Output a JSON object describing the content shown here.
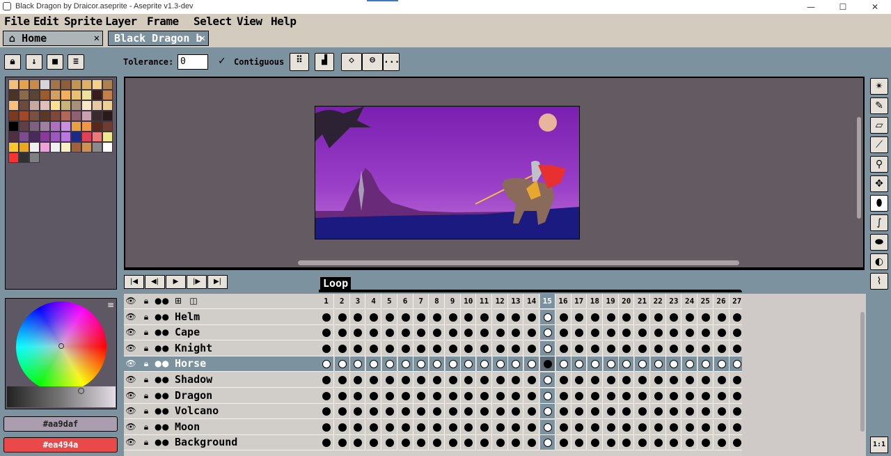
{
  "window": {
    "title": "Black Dragon by Draicor.aseprite - Aseprite v1.3-dev",
    "min": "—",
    "max": "☐",
    "close": "✕"
  },
  "menu": [
    "File",
    "Edit",
    "Sprite",
    "Layer",
    "Frame",
    "Select",
    "View",
    "Help"
  ],
  "tabs": [
    {
      "label": "Home",
      "icon": "home-icon",
      "close": "✕"
    },
    {
      "label": "Black Dragon b",
      "close": "✕"
    }
  ],
  "toolbar": {
    "tolerance_label": "Tolerance:",
    "tolerance_value": "0",
    "contiguous_label": "Contiguous",
    "contiguous_checked": "✓",
    "more": "..."
  },
  "layer_buttons": [
    "lock-icon",
    "arrow-down-icon",
    "square-icon",
    "menu-icon"
  ],
  "palette": [
    "#f3c07a",
    "#e4a14e",
    "#c98b45",
    "#d6d6d6",
    "#a57548",
    "#8d5e3a",
    "#c3964f",
    "#dfb06a",
    "#f5d08a",
    "#b07f4f",
    "#4a3424",
    "#8a6a4a",
    "#5a4434",
    "#9a5e2e",
    "#d4a060",
    "#f0b060",
    "#e8c070",
    "#f0e0a0",
    "#3a1a1a",
    "#c4804a",
    "#f8c078",
    "#6e4a3a",
    "#c8a8a0",
    "#e0c0b8",
    "#ffe090",
    "#c8b478",
    "#a89078",
    "#f8e8c8",
    "#e8c8a0",
    "#f0d090",
    "#7a3a20",
    "#a04828",
    "#7a5040",
    "#5a3828",
    "#804838",
    "#b06858",
    "#906070",
    "#c8a0b0",
    "#3a2a2a",
    "#2a1a1a",
    "#000000",
    "#604048",
    "#806080",
    "#a080a0",
    "#b070c0",
    "#c890e0",
    "#e8a040",
    "#f09848",
    "#5a2818",
    "#703c30",
    "#503040",
    "#7c4c8c",
    "#4a2a5a",
    "#8a3a9a",
    "#9c58c0",
    "#b878e0",
    "#1a2a8a",
    "#e04058",
    "#f07878",
    "#f0e890",
    "#ffc828",
    "#e8a820",
    "#f0f0f0",
    "#f0a0d8",
    "#f0f0f0",
    "#f8f0c0",
    "#a06038",
    "#d09050",
    "#8a8a8a",
    "#ffffff",
    "#ff3030",
    "#303030",
    "#808080"
  ],
  "colors": {
    "fg": "#aa9daf",
    "bg": "#ea494a"
  },
  "playback": [
    "first-frame-icon",
    "prev-frame-icon",
    "play-icon",
    "next-frame-icon",
    "last-frame-icon"
  ],
  "timeline": {
    "tag": "Loop",
    "frames": [
      "1",
      "2",
      "3",
      "4",
      "5",
      "6",
      "7",
      "8",
      "9",
      "10",
      "11",
      "12",
      "13",
      "14",
      "15",
      "16",
      "17",
      "18",
      "19",
      "20",
      "21",
      "22",
      "23",
      "24",
      "25",
      "26",
      "27"
    ],
    "current_frame": "15",
    "header_icons": [
      "eye-icon",
      "lock-icon",
      "continuous-icon",
      "layers-icon",
      "frame-icon"
    ],
    "layers": [
      {
        "name": "Helm",
        "selected": false
      },
      {
        "name": "Cape",
        "selected": false
      },
      {
        "name": "Knight",
        "selected": false
      },
      {
        "name": "Horse",
        "selected": true
      },
      {
        "name": "Shadow",
        "selected": false
      },
      {
        "name": "Dragon",
        "selected": false
      },
      {
        "name": "Volcano",
        "selected": false
      },
      {
        "name": "Moon",
        "selected": false
      },
      {
        "name": "Background",
        "selected": false
      }
    ]
  },
  "zoom": "1:1",
  "tools": [
    "magic-wand-icon",
    "pencil-icon",
    "eraser-icon",
    "eyedropper-icon",
    "zoom-icon",
    "move-icon",
    "fill-icon",
    "curve-icon",
    "ellipse-icon",
    "contour-icon",
    "blur-icon"
  ]
}
